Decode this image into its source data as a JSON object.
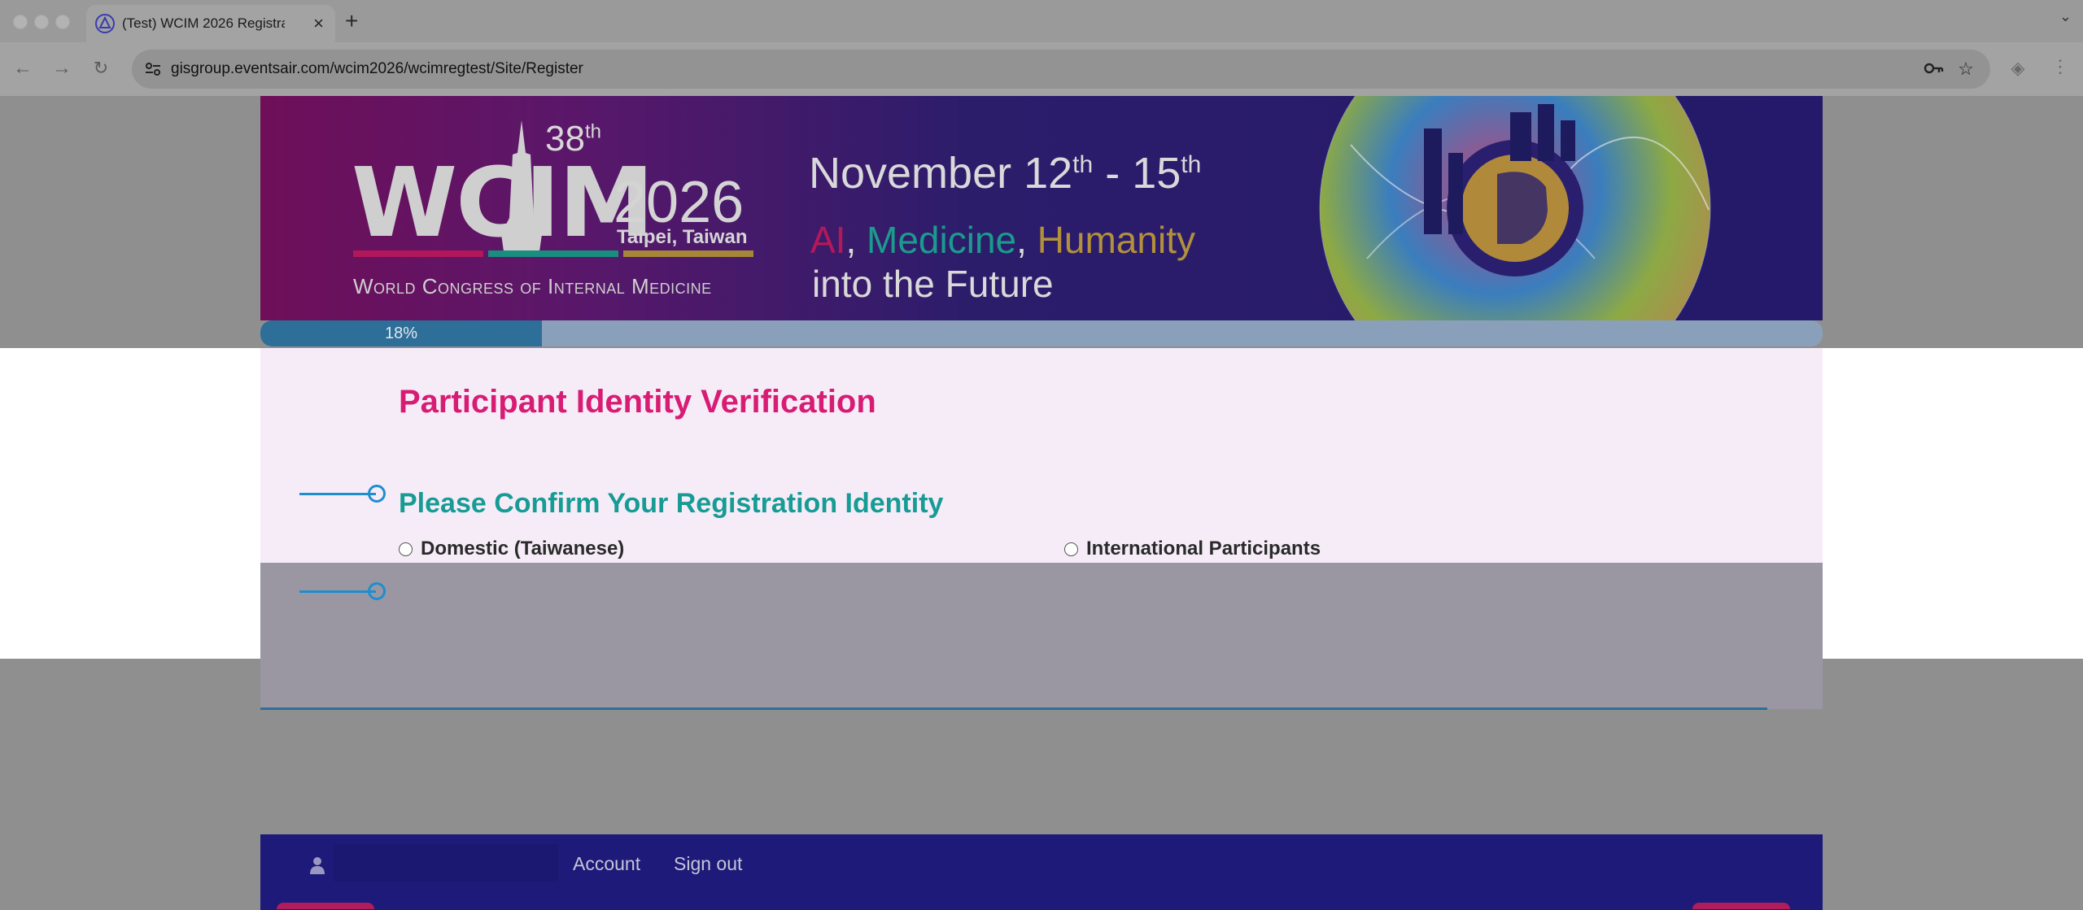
{
  "browser": {
    "tab_title": "(Test) WCIM 2026 Registratio",
    "tab_close": "×",
    "new_tab": "+",
    "tab_menu": "⌄",
    "url": "gisgroup.eventsair.com/wcim2026/wcimregtest/Site/Register",
    "icons": [
      "back-icon",
      "forward-icon",
      "reload-icon",
      "site-settings-icon",
      "password-key-icon",
      "bookmark-star-icon",
      "extension-icon",
      "menu-dots-icon"
    ]
  },
  "banner": {
    "ordinal": "38",
    "ordinal_suffix": "th",
    "logo_text": "WCIM",
    "year": "2026",
    "city": "Taipei, Taiwan",
    "congress_name": "World Congress of Internal Medicine",
    "dates_start": "November 12",
    "dates_start_suffix": "th",
    "dates_sep": " - 15",
    "dates_end_suffix": "th",
    "tag_ai": "AI",
    "tag_medicine": "Medicine",
    "tag_humanity": "Humanity",
    "tag_comma": ",",
    "tagline2": "into the Future"
  },
  "progress": {
    "label": "18%",
    "fraction": 0.18
  },
  "form": {
    "title": "Participant Identity Verification",
    "section_title": "Please Confirm Your Registration Identity",
    "options": [
      {
        "label": "Domestic (Taiwanese)",
        "selected": false
      },
      {
        "label": "International Participants",
        "selected": false
      }
    ]
  },
  "footer": {
    "account": "Account",
    "sign_out": "Sign out"
  },
  "colors": {
    "title_magenta": "#d81c74",
    "section_teal": "#169c94",
    "step_blue": "#1e8ed0",
    "footer_navy": "#1d1a79"
  }
}
